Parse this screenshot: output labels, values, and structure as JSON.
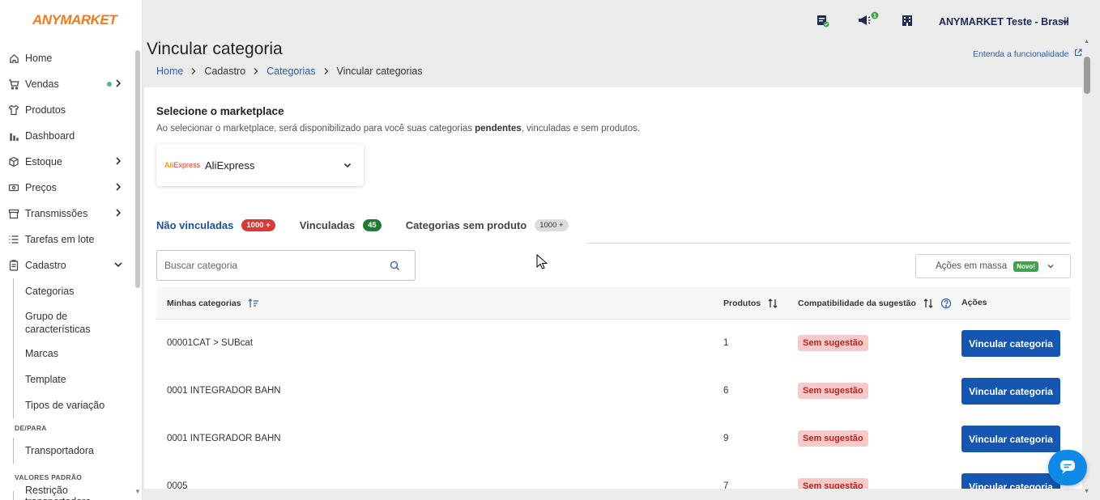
{
  "brand": {
    "logo": "ANYMARKET",
    "color": "#f07a1c"
  },
  "sidebar": {
    "items": [
      {
        "label": "Home",
        "icon": "home-icon"
      },
      {
        "label": "Vendas",
        "icon": "cart-icon"
      },
      {
        "label": "Produtos",
        "icon": "shirt-icon"
      },
      {
        "label": "Dashboard",
        "icon": "bar-chart-icon"
      },
      {
        "label": "Estoque",
        "icon": "box-icon"
      },
      {
        "label": "Preços",
        "icon": "money-icon"
      },
      {
        "label": "Transmissões",
        "icon": "store-icon"
      },
      {
        "label": "Tarefas em lote",
        "icon": "list-icon"
      },
      {
        "label": "Cadastro",
        "icon": "clipboard-icon"
      }
    ],
    "cadastro_sub": [
      "Categorias",
      "Grupo de características",
      "Marcas",
      "Template",
      "Tipos de variação"
    ],
    "section_depara": "DE/PARA",
    "depara_sub": [
      "Transportadora"
    ],
    "section_valores": "VALORES PADRÃO",
    "valores_sub": [
      "Restrição transportadora"
    ]
  },
  "header": {
    "user": "ANYMARKET Teste - Brasil",
    "notification_count": "1"
  },
  "page": {
    "title": "Vincular categoria",
    "breadcrumb": {
      "home": "Home",
      "cadastro": "Cadastro",
      "categorias": "Categorias",
      "current": "Vincular categorias"
    },
    "learn_more": "Entenda a funcionalidade"
  },
  "marketplace": {
    "title": "Selecione o marketplace",
    "desc_pre": "Ao selecionar o marketplace, será disponibilizado para você suas categorias ",
    "desc_bold": "pendentes",
    "desc_post": ", vinculadas e sem produtos.",
    "logo_a": "Ali",
    "logo_b": "Express",
    "selected": "AliExpress"
  },
  "tabs": [
    {
      "label": "Não vinculadas",
      "count": "1000 +"
    },
    {
      "label": "Vinculadas",
      "count": "45"
    },
    {
      "label": "Categorias sem produto",
      "count": "1000 +"
    }
  ],
  "search": {
    "placeholder": "Buscar categoria"
  },
  "mass_actions": {
    "label": "Ações em massa",
    "badge": "Novo!"
  },
  "table": {
    "headers": {
      "category": "Minhas categorias",
      "products": "Produtos",
      "compat": "Compatibilidade da sugestão",
      "actions": "Ações"
    },
    "rows": [
      {
        "category": "00001CAT > SUBcat",
        "products": "1",
        "status": "Sem sugestão",
        "action": "Vincular categoria"
      },
      {
        "category": "0001 INTEGRADOR BAHN",
        "products": "6",
        "status": "Sem sugestão",
        "action": "Vincular categoria"
      },
      {
        "category": "0001 INTEGRADOR BAHN",
        "products": "9",
        "status": "Sem sugestão",
        "action": "Vincular categoria"
      },
      {
        "category": "0005",
        "products": "7",
        "status": "Sem sugestão",
        "action": "Vincular categoria"
      }
    ]
  },
  "colors": {
    "primary": "#1557b0",
    "danger_bg": "#f7c9c9",
    "danger_text": "#b3261e",
    "pill_red": "#d83a3a",
    "pill_green": "#1e7d34"
  }
}
